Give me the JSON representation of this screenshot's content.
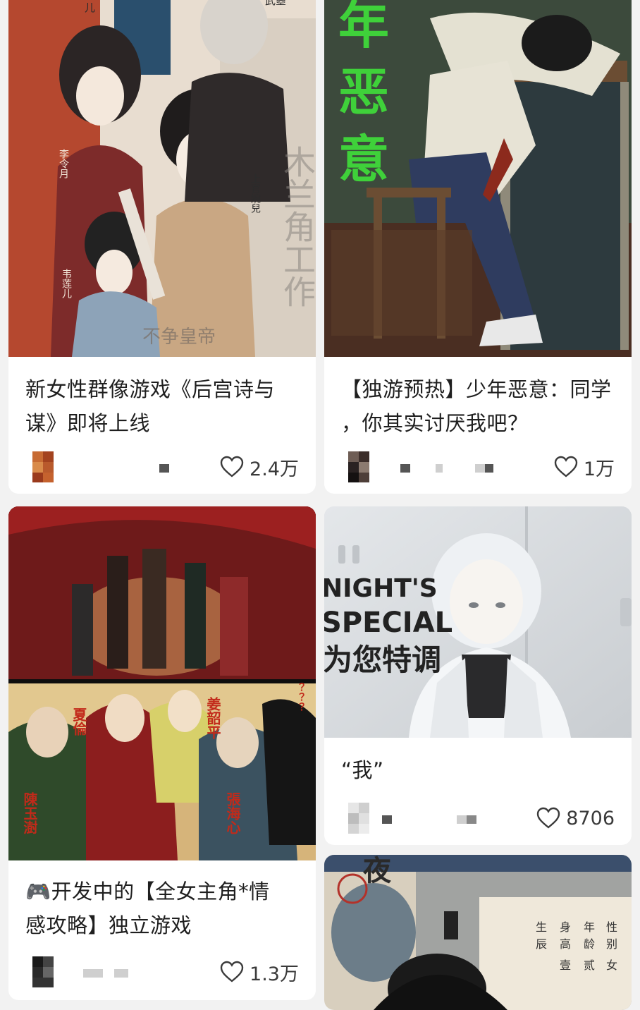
{
  "feed": {
    "cards": [
      {
        "title_line1": "新女性群像游戏《后宫诗与",
        "title_line2": "谋》即将上线",
        "cover_text_1": "武曌",
        "cover_text_2": "李令月",
        "cover_text_3": "上官婉兒",
        "cover_text_4": "韦莲儿",
        "cover_text_5": "木兰角工作",
        "cover_text_6": "不争皇帝",
        "cover_text_7": "儿",
        "likes": "2.4万"
      },
      {
        "title_line1": "【独游预热】少年恶意：同学",
        "title_line2": "，你其实讨厌我吧？",
        "cover_text_1": "年",
        "cover_text_2": "恶",
        "cover_text_3": "意",
        "likes": "1万"
      },
      {
        "title_line1": "🎮开发中的【全女主角*情",
        "title_line2": "感攻略】独立游戏",
        "cover_text_1": "夏倫",
        "cover_text_2": "姜韶平",
        "cover_text_3": "陳玉澍",
        "cover_text_4": "張海心",
        "cover_text_5": "？？？",
        "likes": "1.3万"
      },
      {
        "title": "“我”",
        "cover_text_1": "NIGHT'S",
        "cover_text_2": "SPECIAL",
        "cover_text_3": "为您特调",
        "likes": "8706"
      },
      {
        "cover_text_1": "夜",
        "cover_text_2": "生",
        "cover_text_3": "身",
        "cover_text_4": "年",
        "cover_text_5": "性",
        "cover_text_6": "辰",
        "cover_text_7": "高",
        "cover_text_8": "龄",
        "cover_text_9": "别",
        "cover_text_10": "壹",
        "cover_text_11": "贰",
        "cover_text_12": "女"
      }
    ]
  },
  "colors": {
    "background": "#f2f2f2",
    "card": "#ffffff",
    "title_text": "#1f1f1f",
    "like_text": "#3a3a3a",
    "horror_green": "#3fd13a"
  },
  "icons": {
    "like": "heart-outline-icon"
  }
}
